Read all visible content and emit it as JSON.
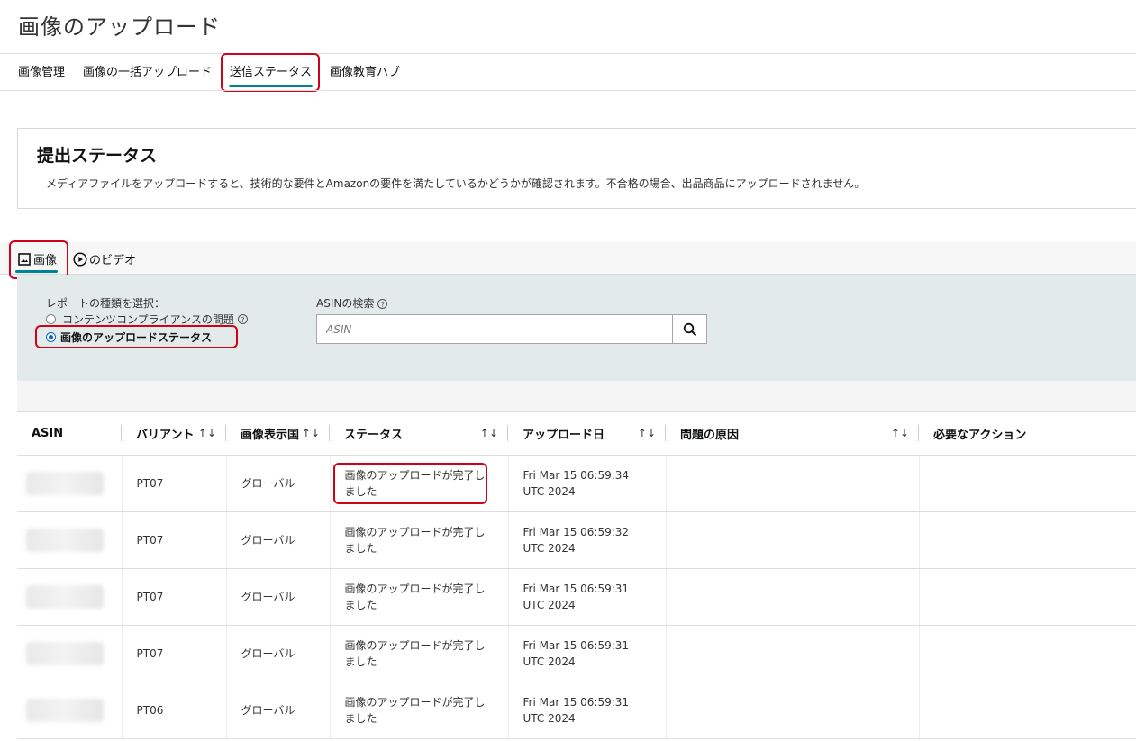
{
  "page": {
    "title": "画像のアップロード"
  },
  "nav": {
    "items": [
      {
        "label": "画像管理"
      },
      {
        "label": "画像の一括アップロード"
      },
      {
        "label": "送信ステータス"
      },
      {
        "label": "画像教育ハブ"
      }
    ]
  },
  "panel": {
    "title": "提出ステータス",
    "description": "メディアファイルをアップロードすると、技術的な要件とAmazonの要件を満たしているかどうかが確認されます。不合格の場合、出品商品にアップロードされません。"
  },
  "media_tabs": {
    "images": "画像",
    "videos": "のビデオ"
  },
  "filter": {
    "report_label": "レポートの種類を選択：",
    "option_compliance": "コンテンツコンプライアンスの問題",
    "option_upload_status": "画像のアップロードステータス",
    "asin_search_label": "ASINの検索",
    "asin_placeholder": "ASIN"
  },
  "table": {
    "headers": [
      "ASIN",
      "バリアント",
      "画像表示国",
      "ステータス",
      "アップロード日",
      "問題の原因",
      "必要なアクション"
    ],
    "rows": [
      {
        "variant": "PT07",
        "country": "グローバル",
        "status": "画像のアップロードが完了しました",
        "date": "Fri Mar 15 06:59:34 UTC 2024"
      },
      {
        "variant": "PT07",
        "country": "グローバル",
        "status": "画像のアップロードが完了しました",
        "date": "Fri Mar 15 06:59:32 UTC 2024"
      },
      {
        "variant": "PT07",
        "country": "グローバル",
        "status": "画像のアップロードが完了しました",
        "date": "Fri Mar 15 06:59:31 UTC 2024"
      },
      {
        "variant": "PT07",
        "country": "グローバル",
        "status": "画像のアップロードが完了しました",
        "date": "Fri Mar 15 06:59:31 UTC 2024"
      },
      {
        "variant": "PT06",
        "country": "グローバル",
        "status": "画像のアップロードが完了しました",
        "date": "Fri Mar 15 06:59:31 UTC 2024"
      }
    ]
  },
  "colors": {
    "accent": "#008296",
    "highlight": "#d0021b",
    "filter_bg": "#e3eaea"
  }
}
